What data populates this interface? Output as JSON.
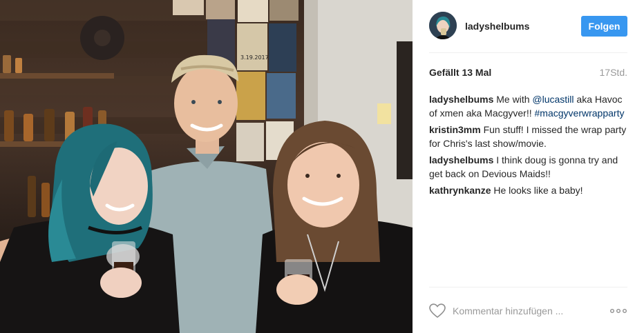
{
  "post": {
    "username": "ladyshelbums",
    "follow_label": "Folgen",
    "likes_text": "Gefällt 13 Mal",
    "time_text": "17Std."
  },
  "comments": [
    {
      "author": "ladyshelbums",
      "parts": [
        {
          "type": "text",
          "text": " Me with "
        },
        {
          "type": "mention",
          "text": "@lucastill"
        },
        {
          "type": "text",
          "text": " aka Havoc of xmen aka Macgyver!! "
        },
        {
          "type": "tag",
          "text": "#macgyverwrapparty"
        }
      ]
    },
    {
      "author": "kristin3mm",
      "parts": [
        {
          "type": "text",
          "text": " Fun stuff! I missed the wrap party for Chris's last show/movie."
        }
      ]
    },
    {
      "author": "ladyshelbums",
      "parts": [
        {
          "type": "text",
          "text": " I think doug is gonna try and get back on Devious Maids!!"
        }
      ]
    },
    {
      "author": "kathrynkanze",
      "parts": [
        {
          "type": "text",
          "text": " He looks like a baby!"
        }
      ]
    }
  ],
  "comment_box": {
    "placeholder": "Kommentar hinzufügen ..."
  },
  "photo": {
    "poster_text": "3.19.2017"
  },
  "icons": {
    "like": "heart-outline-icon",
    "more": "more-options-icon"
  },
  "colors": {
    "follow_button": "#3897f0",
    "link": "#003569",
    "muted": "#999999",
    "separator": "#efefef"
  }
}
